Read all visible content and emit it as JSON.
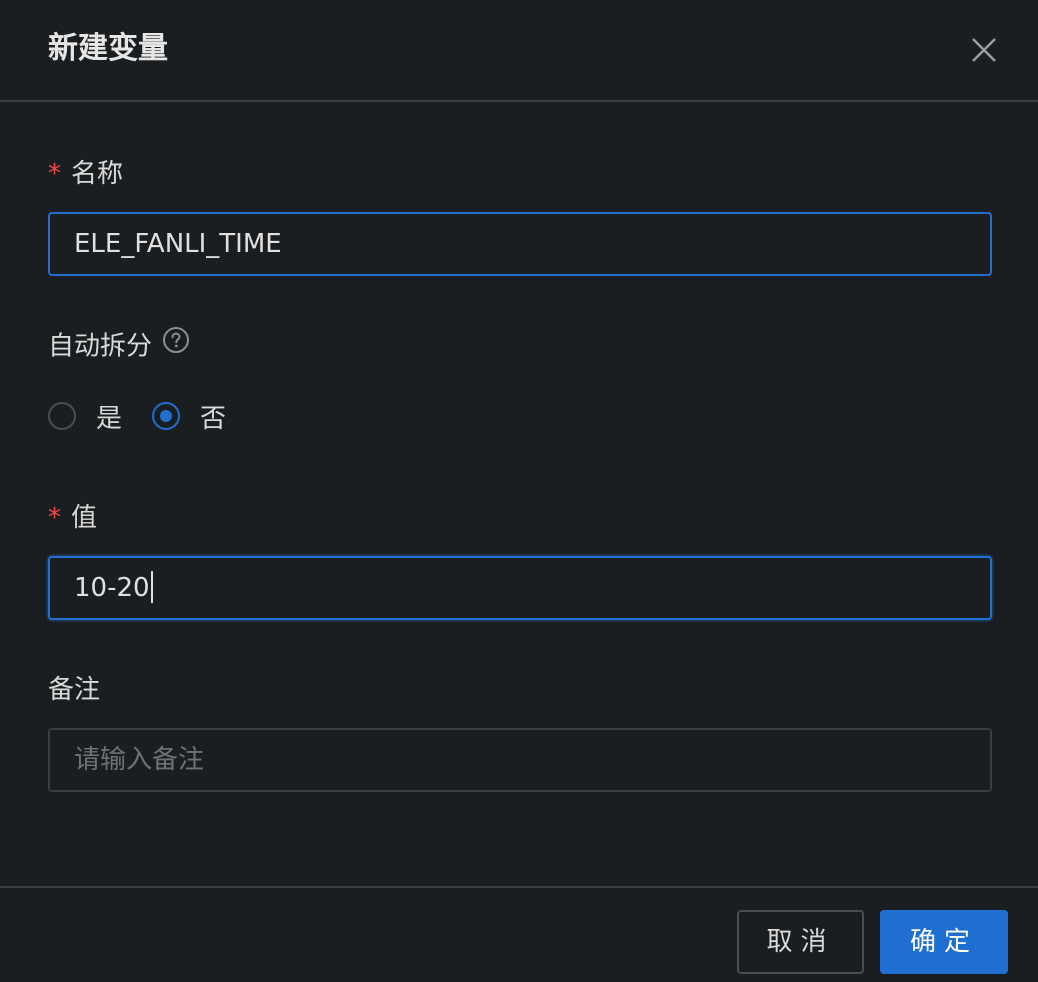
{
  "dialog": {
    "title": "新建变量"
  },
  "form": {
    "name": {
      "required_mark": "*",
      "label": "名称",
      "value": "ELE_FANLI_TIME"
    },
    "auto_split": {
      "label": "自动拆分",
      "options": [
        {
          "label": "是",
          "checked": false
        },
        {
          "label": "否",
          "checked": true
        }
      ]
    },
    "value": {
      "required_mark": "*",
      "label": "值",
      "value": "10-20"
    },
    "remark": {
      "label": "备注",
      "placeholder": "请输入备注"
    }
  },
  "footer": {
    "cancel_label": "取消",
    "ok_label": "确定"
  },
  "colors": {
    "background": "#1b1e20",
    "border": "#3a3d40",
    "accent": "#1f6fd1",
    "required": "#f04a4a"
  },
  "icons": {
    "close": "close-icon",
    "help": "question-circle-icon"
  }
}
